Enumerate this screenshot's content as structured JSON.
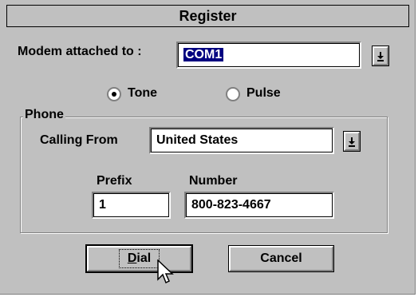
{
  "window": {
    "title": "Register"
  },
  "modem": {
    "label": "Modem attached to :",
    "value": "COM1"
  },
  "dial_mode": {
    "tone_label": "Tone",
    "pulse_label": "Pulse",
    "selected": "Tone"
  },
  "phone": {
    "group_label": "Phone",
    "calling_from_label": "Calling From",
    "calling_from_value": "United States",
    "prefix_label": "Prefix",
    "prefix_value": "1",
    "number_label": "Number",
    "number_value": "800-823-4667"
  },
  "buttons": {
    "dial_mnemonic": "D",
    "dial_rest": "ial",
    "cancel_label": "Cancel"
  },
  "icons": {
    "dropdown": "chevron-down-icon",
    "cursor": "mouse-pointer-icon"
  }
}
